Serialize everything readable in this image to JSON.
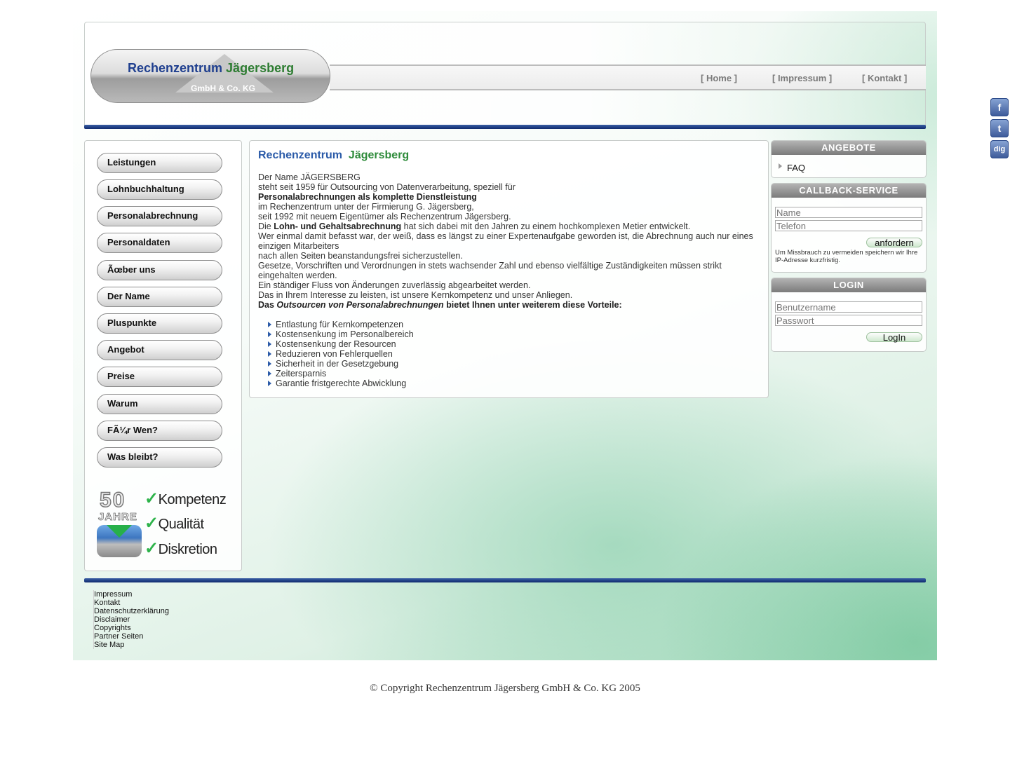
{
  "logo": {
    "title_part1": "Rechenzentrum",
    "title_part2": "Jägersberg",
    "subtitle": "GmbH & Co. KG"
  },
  "top_nav": {
    "home": "[ Home ]",
    "impressum": "[ Impressum ]",
    "kontakt": "[ Kontakt ]"
  },
  "social": [
    {
      "icon": "facebook-icon",
      "glyph": "f"
    },
    {
      "icon": "twitter-icon",
      "glyph": "t"
    },
    {
      "icon": "digg-icon",
      "glyph": "dig"
    }
  ],
  "left_nav": [
    "Leistungen",
    "Lohnbuchhaltung",
    "Personalabrechnung",
    "Personaldaten",
    "Ãœber uns",
    "Der Name",
    "Pluspunkte",
    "Angebot",
    "Preise",
    "Warum",
    "FÃ¼r Wen?",
    "Was bleibt?"
  ],
  "badge": {
    "number": "50",
    "jahre": "JAHRE",
    "words": [
      "Kompetenz",
      "Qualität",
      "Diskretion"
    ],
    "check": "✓"
  },
  "main": {
    "title_part1": "Rechenzentrum",
    "title_part2": "Jägersberg",
    "line1": "Der Name JÄGERSBERG",
    "line2": "steht seit 1959 für Outsourcing von Datenverarbeitung, speziell für",
    "line3": "Personalabrechnungen als komplette Dienstleistung",
    "line4": "im Rechenzentrum unter der Firmierung G. Jägersberg,",
    "line5": "seit 1992 mit neuem Eigentümer als Rechenzentrum Jägersberg.",
    "line6_a": "Die ",
    "line6_b": "Lohn- und Gehaltsabrechnung",
    "line6_c": " hat sich dabei mit den Jahren zu einem hochkomplexen Metier entwickelt.",
    "line7": "Wer einmal damit befasst war, der weiß, dass es längst zu einer Expertenaufgabe geworden ist, die Abrechnung auch nur eines einzigen Mitarbeiters",
    "line8": "nach allen Seiten beanstandungsfrei sicherzustellen.",
    "line9": "Gesetze, Vorschriften und Verordnungen in stets wachsender Zahl und ebenso vielfältige Zuständigkeiten müssen strikt eingehalten werden.",
    "line10": "Ein ständiger Fluss von Änderungen zuverlässig abgearbeitet werden.",
    "line11": "Das in Ihrem Interesse zu leisten, ist unsere Kernkompetenz und unser Anliegen.",
    "line12_a": "Das ",
    "line12_b": "Outsourcen von Personalabrechnungen",
    "line12_c": " bietet Ihnen unter weiterem diese Vorteile:",
    "bullets": [
      "Entlastung für Kernkompetenzen",
      "Kostensenkung im Personalbereich",
      "Kostensenkung der Resourcen",
      "Reduzieren von Fehlerquellen",
      "Sicherheit in der Gesetzgebung",
      "Zeitersparnis",
      "Garantie fristgerechte Abwicklung"
    ]
  },
  "angebote": {
    "heading": "ANGEBOTE",
    "item": "FAQ"
  },
  "callback": {
    "heading": "CALLBACK-SERVICE",
    "name_placeholder": "Name",
    "phone_placeholder": "Telefon",
    "button": "anfordern",
    "note": "Um Missbrauch zu vermeiden speichern wir Ihre IP-Adresse kurzfristig."
  },
  "login": {
    "heading": "LOGIN",
    "user_placeholder": "Benutzername",
    "pass_placeholder": "Passwort",
    "button": "LogIn"
  },
  "footer_links": [
    "Impressum",
    "Kontakt",
    "Datenschutzerklärung",
    "Disclaimer",
    "Copyrights",
    "Partner Seiten",
    "Site Map"
  ],
  "copyright": "© Copyright Rechenzentrum Jägersberg GmbH & Co. KG 2005",
  "colors": {
    "navy_bar": "#0f2a6e",
    "title_blue": "#2a5aa8",
    "title_green": "#2e8b3a"
  }
}
